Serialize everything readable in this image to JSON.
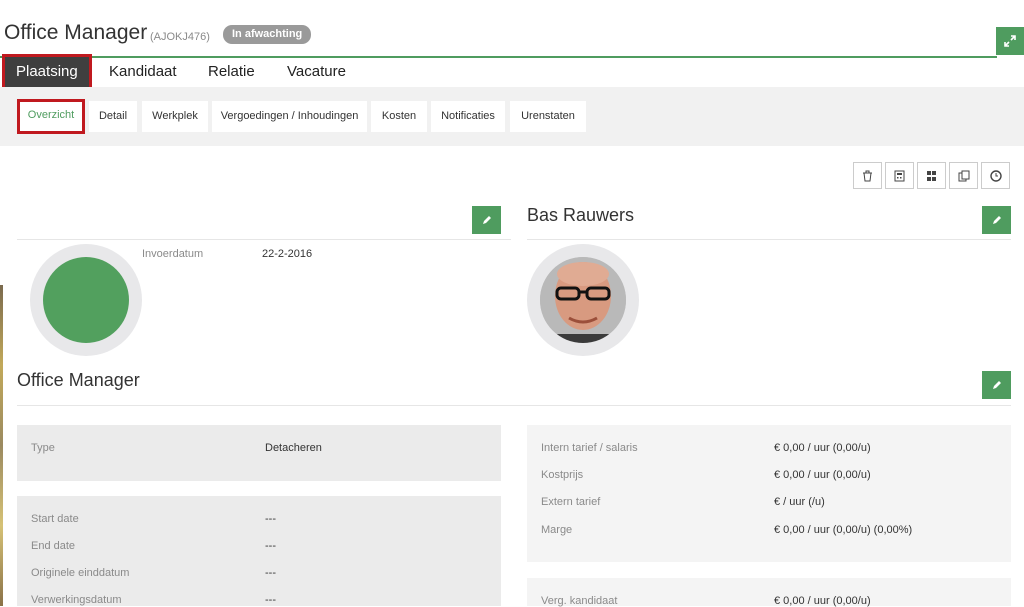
{
  "header": {
    "title": "Office Manager",
    "code": "(AJOKJ476)",
    "status": "In afwachting",
    "expand_icon": "expand-icon"
  },
  "main_tabs": [
    {
      "label": "Plaatsing",
      "active": true
    },
    {
      "label": "Kandidaat",
      "active": false
    },
    {
      "label": "Relatie",
      "active": false
    },
    {
      "label": "Vacature",
      "active": false
    }
  ],
  "sub_tabs": [
    {
      "label": "Overzicht",
      "active": true
    },
    {
      "label": "Detail",
      "active": false
    },
    {
      "label": "Werkplek",
      "active": false
    },
    {
      "label": "Vergoedingen / Inhoudingen",
      "active": false
    },
    {
      "label": "Kosten",
      "active": false
    },
    {
      "label": "Notificaties",
      "active": false
    },
    {
      "label": "Urenstaten",
      "active": false
    }
  ],
  "toolbar": {
    "icons": [
      "trash-icon",
      "calculator-icon",
      "grid-icon",
      "copy-icon",
      "clock-icon"
    ]
  },
  "placement": {
    "invoerdatum_label": "Invoerdatum",
    "invoerdatum_value": "22-2-2016",
    "avatar_color": "#52a05e"
  },
  "candidate": {
    "name": "Bas Rauwers"
  },
  "job": {
    "title": "Office Manager",
    "type_label": "Type",
    "type_value": "Detacheren",
    "dates": [
      {
        "label": "Start date",
        "value": "---"
      },
      {
        "label": "End date",
        "value": "---"
      },
      {
        "label": "Originele einddatum",
        "value": "---"
      },
      {
        "label": "Verwerkingsdatum",
        "value": "---"
      }
    ],
    "rates": [
      {
        "label": "Intern tarief / salaris",
        "value": "€ 0,00 / uur (0,00/u)"
      },
      {
        "label": "Kostprijs",
        "value": "€ 0,00 / uur (0,00/u)"
      },
      {
        "label": "Extern tarief",
        "value": "€ / uur (/u)"
      },
      {
        "label": "Marge",
        "value": "€ 0,00 / uur (0,00/u) (0,00%)"
      }
    ],
    "verg_label": "Verg. kandidaat",
    "verg_value": "€ 0,00 / uur (0,00/u)"
  },
  "colors": {
    "accent": "#4f9c5f",
    "highlight": "#c0191f"
  }
}
